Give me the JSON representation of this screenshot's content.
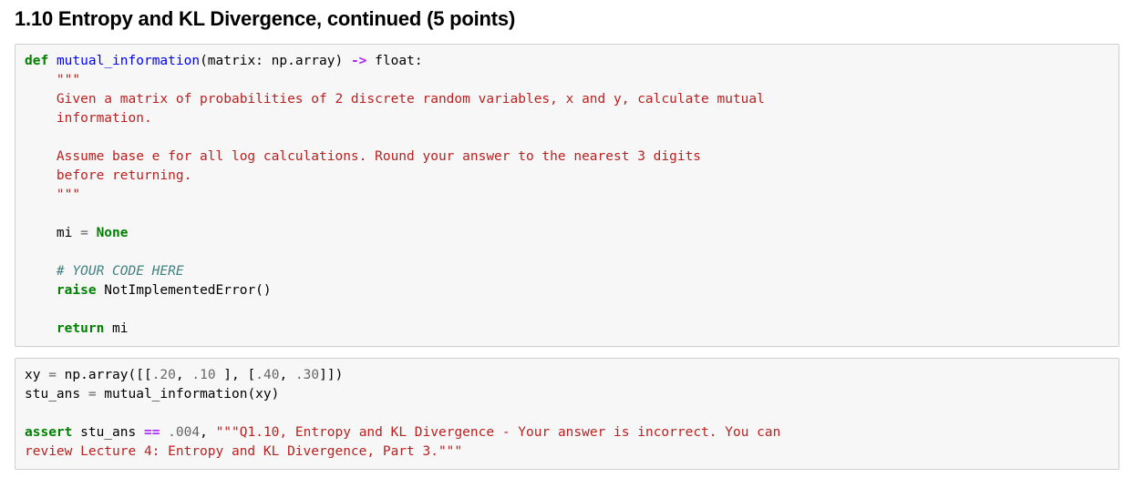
{
  "heading": "1.10 Entropy and KL Divergence, continued (5 points)",
  "cell1": {
    "kw_def": "def",
    "fn_name": "mutual_information",
    "sig_open": "(matrix: np.array) ",
    "arrow": "->",
    "ret_type": " float",
    "sig_close": ":",
    "doc_open": "    \"\"\"",
    "doc_l1": "    Given a matrix of probabilities of 2 discrete random variables, x and y, calculate mutual",
    "doc_l2": "    information.",
    "doc_blank": "",
    "doc_l3": "    Assume base e for all log calculations. Round your answer to the nearest 3 digits",
    "doc_l4": "    before returning.",
    "doc_close": "    \"\"\"",
    "mi_indent": "    mi ",
    "mi_eq": "=",
    "mi_none": " None",
    "comment": "    # YOUR CODE HERE",
    "raise_kw": "    raise",
    "raise_exc": " NotImplementedError()",
    "return_kw": "    return",
    "return_var": " mi"
  },
  "cell2": {
    "l1a": "xy ",
    "l1eq": "=",
    "l1b": " np.array([[",
    "n1": ".20",
    "c1": ", ",
    "n2": ".10",
    "l1c": " ], [",
    "n3": ".40",
    "c2": ", ",
    "n4": ".30",
    "l1d": "]])",
    "l2a": "stu_ans ",
    "l2eq": "=",
    "l2b": " mutual_information(xy)",
    "l3kw": "assert",
    "l3a": " stu_ans ",
    "l3op": "==",
    "l3sp": " ",
    "l3num": ".004",
    "l3c": ", ",
    "l3s1": "\"\"\"Q1.10, Entropy and KL Divergence - Your answer is incorrect. You can",
    "l3s2": "review Lecture 4: Entropy and KL Divergence, Part 3.\"\"\""
  }
}
